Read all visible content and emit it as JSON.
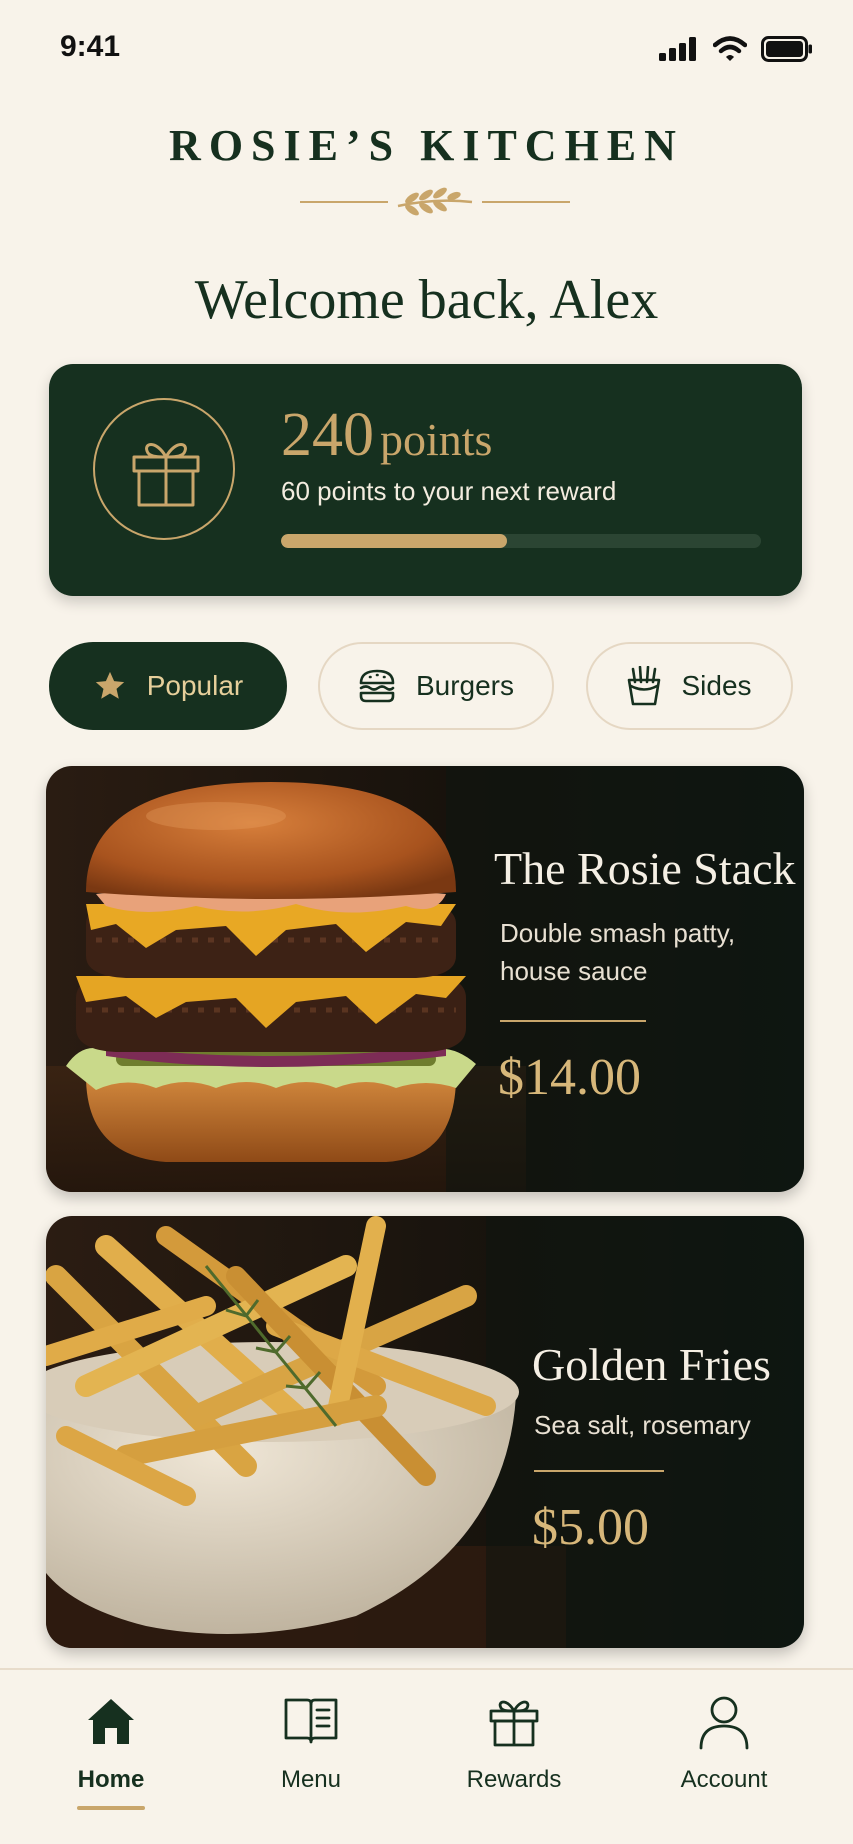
{
  "status_bar": {
    "time": "9:41"
  },
  "brand": {
    "name": "ROSIE’S KITCHEN"
  },
  "greeting": "Welcome back, Alex",
  "rewards": {
    "points_value": "240",
    "points_label": "points",
    "subtitle": "60 points to your next reward",
    "progress_fraction": 0.47
  },
  "categories": [
    {
      "label": "Popular",
      "icon": "star-icon",
      "active": true
    },
    {
      "label": "Burgers",
      "icon": "burger-icon",
      "active": false
    },
    {
      "label": "Sides",
      "icon": "fries-icon",
      "active": false
    }
  ],
  "items": [
    {
      "title": "The Rosie Stack",
      "description": "Double smash patty, house sauce",
      "price": "$14.00",
      "image": "burger-photo"
    },
    {
      "title": "Golden Fries",
      "description": "Sea salt, rosemary",
      "price": "$5.00",
      "image": "fries-photo"
    }
  ],
  "tabs": [
    {
      "label": "Home",
      "icon": "home-icon",
      "active": true
    },
    {
      "label": "Menu",
      "icon": "menu-book-icon",
      "active": false
    },
    {
      "label": "Rewards",
      "icon": "gift-icon",
      "active": false
    },
    {
      "label": "Account",
      "icon": "account-icon",
      "active": false
    }
  ],
  "colors": {
    "background": "#f8f3ea",
    "forest_green": "#16301f",
    "gold": "#c9a66b"
  }
}
